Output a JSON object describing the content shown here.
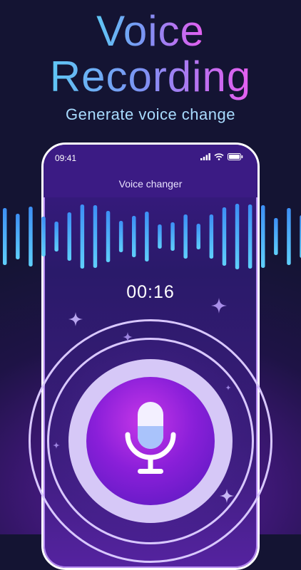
{
  "headline": {
    "line1": "Voice",
    "line2": "Recording",
    "subtitle": "Generate voice change"
  },
  "phone": {
    "status_time": "09:41",
    "screen_title": "Voice changer"
  },
  "recorder": {
    "timer": "00:16"
  },
  "icons": [
    "signal-icon",
    "wifi-icon",
    "battery-icon",
    "microphone-icon",
    "sparkle-icon"
  ],
  "colors": {
    "background": "#141433",
    "title_gradient_start": "#5fc7f5",
    "title_gradient_end": "#e55ff0",
    "subtitle": "#a9dcff",
    "waveform": "#4aa9f5",
    "mic_button": "#8a1fd9",
    "ring": "#d9c8ff"
  }
}
